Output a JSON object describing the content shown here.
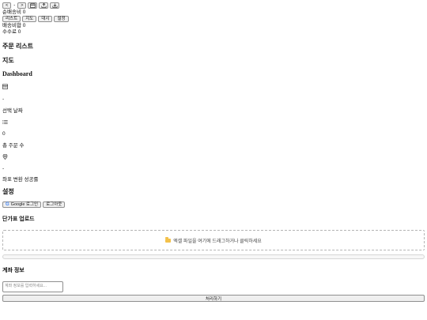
{
  "toolbar": {
    "prev_label": "<",
    "separator": "-",
    "next_label": ">",
    "calendar_icon": "calendar-icon",
    "upload_icon": "upload-icon",
    "download_icon": "download-icon"
  },
  "summary": {
    "shipping_sum": "순배송비 0",
    "shipping_ratio": "배송비합 0",
    "fee": "수수료 0"
  },
  "tabs": [
    "리스트",
    "지도",
    "대시",
    "설정"
  ],
  "sections": {
    "order_list": "주문 리스트",
    "map": "지도",
    "dashboard": "Dashboard"
  },
  "stats": [
    {
      "icon": "calendar-icon",
      "value": "-",
      "label": "선택 날짜"
    },
    {
      "icon": "list-icon",
      "value": "0",
      "label": "총 주문 수"
    },
    {
      "icon": "location-pin-icon",
      "value": "-",
      "label": "좌표 변환 성공률"
    }
  ],
  "settings": {
    "title": "설정",
    "google_login": "Google 로그인",
    "logout": "로그아웃"
  },
  "price_upload": {
    "title": "단가표 업로드",
    "drop_text": "엑셀 파일을 여기에 드래그하거나 클릭하세요",
    "progress_percent": 0
  },
  "account": {
    "title": "계좌 정보",
    "placeholder": "계좌 정보를 입력하세요...",
    "value": "",
    "process_label": "처리하기"
  }
}
